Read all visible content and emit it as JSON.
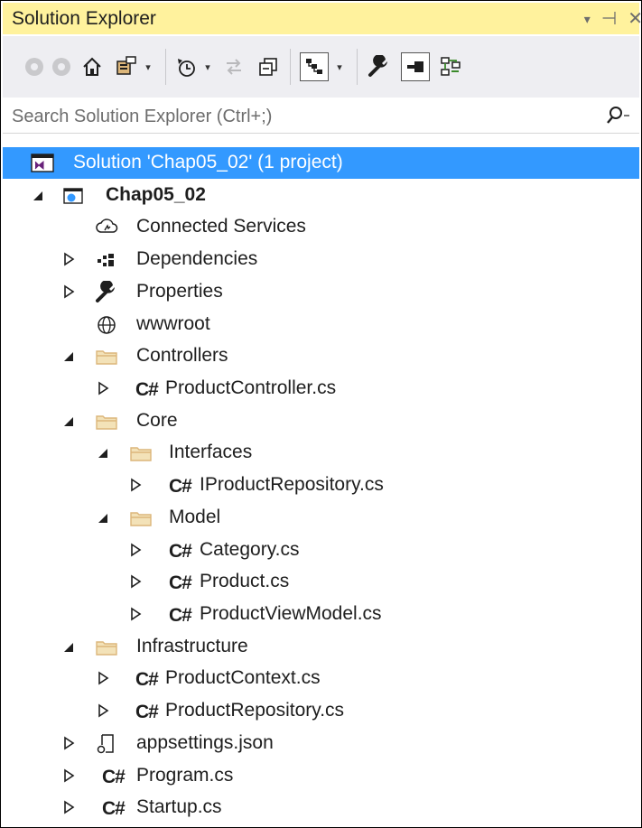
{
  "window": {
    "title": "Solution Explorer",
    "controls": {
      "dropdown": "▾",
      "pin": "⊣",
      "close": "✕"
    }
  },
  "toolbar": {
    "buttons": [
      {
        "name": "back-button",
        "icon": "back-circle-icon"
      },
      {
        "name": "forward-button",
        "icon": "forward-circle-icon"
      },
      {
        "name": "home-button",
        "icon": "home-icon"
      },
      {
        "name": "switch-views-button",
        "icon": "switch-views-icon"
      },
      {
        "name": "pending-changes-button",
        "icon": "history-icon"
      },
      {
        "name": "sync-button",
        "icon": "sync-arrows-icon"
      },
      {
        "name": "collapse-all-button",
        "icon": "collapse-all-icon"
      },
      {
        "name": "show-all-files-button",
        "icon": "show-all-files-icon"
      },
      {
        "name": "properties-button",
        "icon": "wrench-icon"
      },
      {
        "name": "preview-button",
        "icon": "preview-icon"
      },
      {
        "name": "class-diagram-button",
        "icon": "diagram-icon"
      }
    ],
    "dropdown_glyph": "▾"
  },
  "search": {
    "placeholder": "Search Solution Explorer (Ctrl+;)",
    "value": "",
    "icon": "search-icon"
  },
  "tree": [
    {
      "label": "Solution 'Chap05_02' (1 project)",
      "icon": "solution-icon",
      "selected": true
    },
    {
      "label": "Chap05_02",
      "icon": "web-project-icon",
      "expanded": true,
      "bold": true
    },
    {
      "label": "Connected Services",
      "icon": "connected-services-icon"
    },
    {
      "label": "Dependencies",
      "icon": "dependencies-icon",
      "expanded": false
    },
    {
      "label": "Properties",
      "icon": "wrench-icon",
      "expanded": false
    },
    {
      "label": "wwwroot",
      "icon": "globe-icon"
    },
    {
      "label": "Controllers",
      "icon": "folder-icon",
      "expanded": true
    },
    {
      "label": "ProductController.cs",
      "icon": "csharp-file-icon",
      "expanded": false
    },
    {
      "label": "Core",
      "icon": "folder-icon",
      "expanded": true
    },
    {
      "label": "Interfaces",
      "icon": "folder-icon",
      "expanded": true
    },
    {
      "label": "IProductRepository.cs",
      "icon": "csharp-file-icon",
      "expanded": false
    },
    {
      "label": "Model",
      "icon": "folder-icon",
      "expanded": true
    },
    {
      "label": "Category.cs",
      "icon": "csharp-file-icon",
      "expanded": false
    },
    {
      "label": "Product.cs",
      "icon": "csharp-file-icon",
      "expanded": false
    },
    {
      "label": "ProductViewModel.cs",
      "icon": "csharp-file-icon",
      "expanded": false
    },
    {
      "label": "Infrastructure",
      "icon": "folder-icon",
      "expanded": true
    },
    {
      "label": "ProductContext.cs",
      "icon": "csharp-file-icon",
      "expanded": false
    },
    {
      "label": "ProductRepository.cs",
      "icon": "csharp-file-icon",
      "expanded": false
    },
    {
      "label": "appsettings.json",
      "icon": "json-file-icon",
      "expanded": false
    },
    {
      "label": "Program.cs",
      "icon": "csharp-file-icon",
      "expanded": false
    },
    {
      "label": "Startup.cs",
      "icon": "csharp-file-icon",
      "expanded": false
    }
  ],
  "csharp_glyph": "C#",
  "colors": {
    "title_bar": "#fff29d",
    "toolbar": "#eeeef2",
    "selection": "#3399ff",
    "csharp_icon": "#3a8a2a",
    "folder": "#dcb67a"
  }
}
